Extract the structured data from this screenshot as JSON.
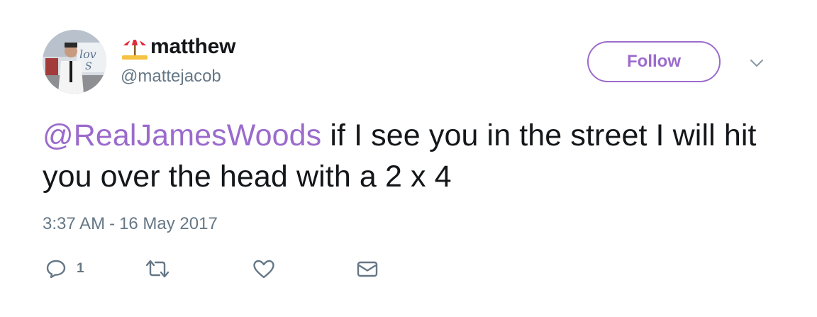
{
  "user": {
    "display_name": "matthew",
    "display_name_emoji": "beach-umbrella-icon",
    "handle": "@mattejacob",
    "avatar": "profile-photo"
  },
  "header": {
    "follow_label": "Follow",
    "more_icon": "chevron-down-icon"
  },
  "tweet": {
    "mention": "@RealJamesWoods",
    "text": " if I see you in the street I will hit you over the head with a 2 x 4",
    "time": "3:37 AM",
    "separator": "-",
    "date": "16 May 2017"
  },
  "actions": {
    "reply_icon": "reply-icon",
    "reply_count": "1",
    "retweet_icon": "retweet-icon",
    "like_icon": "heart-icon",
    "dm_icon": "envelope-icon"
  },
  "colors": {
    "accent": "#9b6bcc",
    "text": "#14171a",
    "muted": "#657786"
  }
}
